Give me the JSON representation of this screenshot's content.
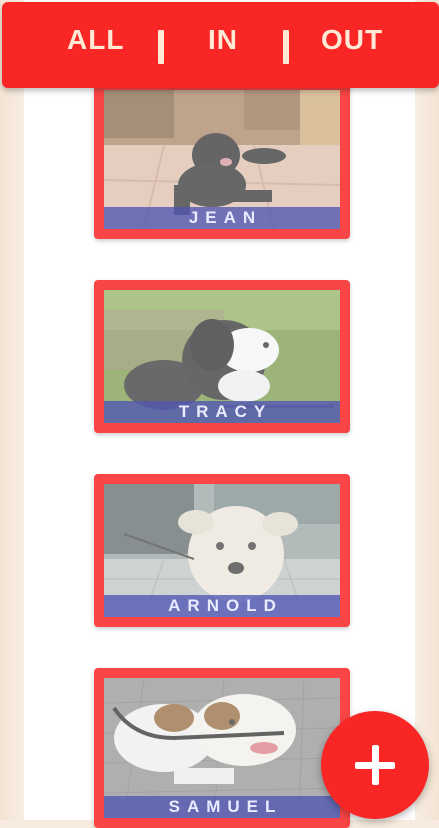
{
  "filters": {
    "all": "ALL",
    "in": "IN",
    "out": "OUT"
  },
  "dogs": [
    {
      "name": "JEAN"
    },
    {
      "name": "TRACY"
    },
    {
      "name": "ARNOLD"
    },
    {
      "name": "SAMUEL"
    }
  ],
  "fab": {
    "icon": "plus-icon"
  },
  "colors": {
    "accent": "#f92626",
    "card": "#f94545",
    "name_band": "#5056b4",
    "filter_text": "#fde9d5"
  }
}
